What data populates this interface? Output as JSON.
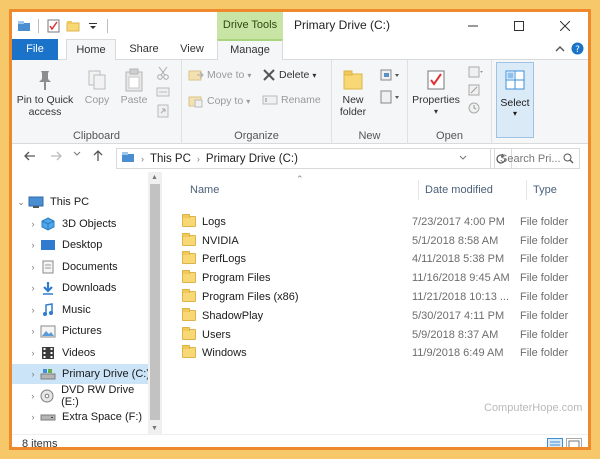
{
  "window": {
    "title": "Primary Drive (C:)",
    "context_tab": "Drive Tools"
  },
  "ribbon_tabs": [
    "File",
    "Home",
    "Share",
    "View",
    "Manage"
  ],
  "ribbon": {
    "clipboard": {
      "label": "Clipboard",
      "pin_line1": "Pin to Quick",
      "pin_line2": "access",
      "copy": "Copy",
      "paste": "Paste"
    },
    "organize": {
      "label": "Organize",
      "move_to": "Move to",
      "copy_to": "Copy to",
      "delete": "Delete",
      "rename": "Rename"
    },
    "new": {
      "label": "New",
      "new_folder_line1": "New",
      "new_folder_line2": "folder"
    },
    "open": {
      "label": "Open",
      "properties": "Properties"
    },
    "select": {
      "label": "Select"
    }
  },
  "address": {
    "crumbs": [
      "This PC",
      "Primary Drive (C:)"
    ],
    "search_placeholder": "Search Pri..."
  },
  "nav": {
    "items": [
      {
        "label": "This PC",
        "icon": "computer-icon",
        "level": 0,
        "expanded": true
      },
      {
        "label": "3D Objects",
        "icon": "cube-icon",
        "level": 1
      },
      {
        "label": "Desktop",
        "icon": "desktop-icon",
        "level": 1
      },
      {
        "label": "Documents",
        "icon": "documents-icon",
        "level": 1
      },
      {
        "label": "Downloads",
        "icon": "download-icon",
        "level": 1
      },
      {
        "label": "Music",
        "icon": "music-icon",
        "level": 1
      },
      {
        "label": "Pictures",
        "icon": "pictures-icon",
        "level": 1
      },
      {
        "label": "Videos",
        "icon": "videos-icon",
        "level": 1
      },
      {
        "label": "Primary Drive (C:)",
        "icon": "drive-icon",
        "level": 1,
        "selected": true
      },
      {
        "label": "DVD RW Drive (E:)",
        "icon": "dvd-icon",
        "level": 1
      },
      {
        "label": "Extra Space (F:)",
        "icon": "drive-icon",
        "level": 1
      }
    ]
  },
  "columns": {
    "name": "Name",
    "date": "Date modified",
    "type": "Type"
  },
  "files": [
    {
      "name": "Logs",
      "date": "7/23/2017 4:00 PM",
      "type": "File folder"
    },
    {
      "name": "NVIDIA",
      "date": "5/1/2018 8:58 AM",
      "type": "File folder"
    },
    {
      "name": "PerfLogs",
      "date": "4/11/2018 5:38 PM",
      "type": "File folder"
    },
    {
      "name": "Program Files",
      "date": "11/16/2018 9:45 AM",
      "type": "File folder"
    },
    {
      "name": "Program Files (x86)",
      "date": "11/21/2018 10:13 ...",
      "type": "File folder"
    },
    {
      "name": "ShadowPlay",
      "date": "5/30/2017 4:11 PM",
      "type": "File folder"
    },
    {
      "name": "Users",
      "date": "5/9/2018 8:37 AM",
      "type": "File folder"
    },
    {
      "name": "Windows",
      "date": "11/9/2018 6:49 AM",
      "type": "File folder"
    }
  ],
  "status": {
    "item_count": "8 items"
  },
  "watermark": "ComputerHope.com",
  "colors": {
    "accent": "#1a73c8",
    "frame_border": "#ef8a2c",
    "background": "#f6c86a",
    "context_tab": "#c9e5a6",
    "selected": "#cce4f7"
  }
}
